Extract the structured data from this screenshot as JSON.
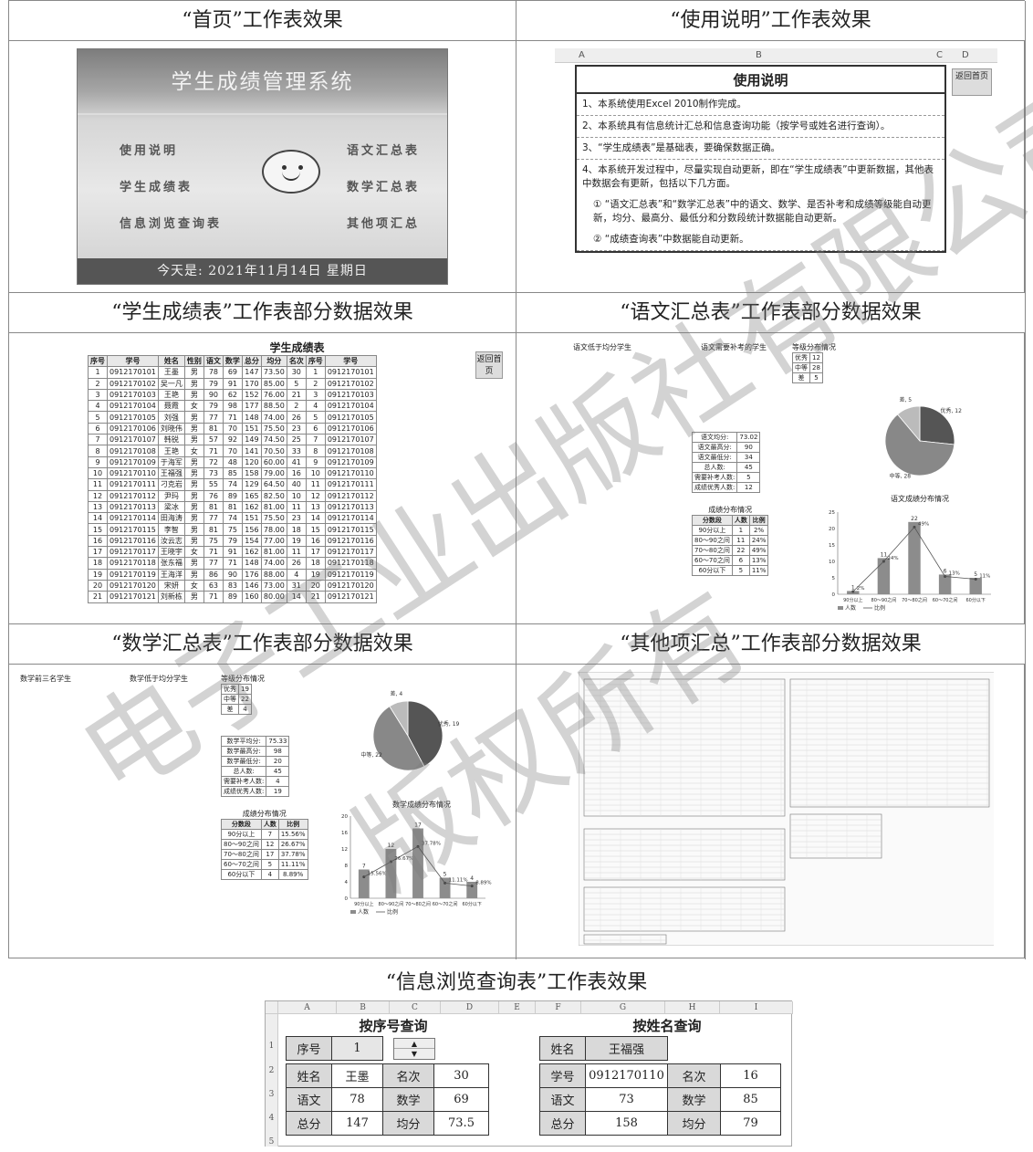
{
  "captions": {
    "home": "“首页”工作表效果",
    "help": "“使用说明”工作表效果",
    "grades": "“学生成绩表”工作表部分数据效果",
    "chinese": "“语文汇总表”工作表部分数据效果",
    "math": "“数学汇总表”工作表部分数据效果",
    "other": "“其他项汇总”工作表部分数据效果",
    "query": "“信息浏览查询表”工作表效果"
  },
  "home": {
    "title": "学生成绩管理系统",
    "items": [
      "使用说明",
      "学生成绩表",
      "信息浏览查询表",
      "语文汇总表",
      "数学汇总表",
      "其他项汇总"
    ],
    "footer": "今天是:    2021年11月14日   星期日"
  },
  "help": {
    "cols": [
      "A",
      "B",
      "C",
      "D"
    ],
    "title": "使用说明",
    "back": "返回首页",
    "lines": [
      "1、本系统使用Excel 2010制作完成。",
      "2、本系统具有信息统计汇总和信息查询功能（按学号或姓名进行查询）。",
      "3、“学生成绩表”是基础表，要确保数据正确。",
      "4、本系统开发过程中，尽量实现自动更新，即在“学生成绩表”中更新数据，其他表中数据会有更新，包括以下几方面。",
      "① “语文汇总表”和“数学汇总表”中的语文、数学、是否补考和成绩等级能自动更新，均分、最高分、最低分和分数段统计数据能自动更新。",
      "② “成绩查询表”中数据能自动更新。"
    ]
  },
  "grades": {
    "title": "学生成绩表",
    "back": "返回首页",
    "headers": [
      "序号",
      "学号",
      "姓名",
      "性别",
      "语文",
      "数学",
      "总分",
      "均分",
      "名次",
      "序号",
      "学号"
    ],
    "rows": [
      [
        "1",
        "0912170101",
        "王墨",
        "男",
        "78",
        "69",
        "147",
        "73.50",
        "30",
        "1",
        "0912170101"
      ],
      [
        "2",
        "0912170102",
        "吴一凡",
        "男",
        "79",
        "91",
        "170",
        "85.00",
        "5",
        "2",
        "0912170102"
      ],
      [
        "3",
        "0912170103",
        "王艳",
        "男",
        "90",
        "62",
        "152",
        "76.00",
        "21",
        "3",
        "0912170103"
      ],
      [
        "4",
        "0912170104",
        "聂霞",
        "女",
        "79",
        "98",
        "177",
        "88.50",
        "2",
        "4",
        "0912170104"
      ],
      [
        "5",
        "0912170105",
        "刘强",
        "男",
        "77",
        "71",
        "148",
        "74.00",
        "26",
        "5",
        "0912170105"
      ],
      [
        "6",
        "0912170106",
        "刘晓伟",
        "男",
        "81",
        "70",
        "151",
        "75.50",
        "23",
        "6",
        "0912170106"
      ],
      [
        "7",
        "0912170107",
        "韩锐",
        "男",
        "57",
        "92",
        "149",
        "74.50",
        "25",
        "7",
        "0912170107"
      ],
      [
        "8",
        "0912170108",
        "王艳",
        "女",
        "71",
        "70",
        "141",
        "70.50",
        "33",
        "8",
        "0912170108"
      ],
      [
        "9",
        "0912170109",
        "于海军",
        "男",
        "72",
        "48",
        "120",
        "60.00",
        "41",
        "9",
        "0912170109"
      ],
      [
        "10",
        "0912170110",
        "王福强",
        "男",
        "73",
        "85",
        "158",
        "79.00",
        "16",
        "10",
        "0912170110"
      ],
      [
        "11",
        "0912170111",
        "刁克岩",
        "男",
        "55",
        "74",
        "129",
        "64.50",
        "40",
        "11",
        "0912170111"
      ],
      [
        "12",
        "0912170112",
        "尹玛",
        "男",
        "76",
        "89",
        "165",
        "82.50",
        "10",
        "12",
        "0912170112"
      ],
      [
        "13",
        "0912170113",
        "梁冰",
        "男",
        "81",
        "81",
        "162",
        "81.00",
        "11",
        "13",
        "0912170113"
      ],
      [
        "14",
        "0912170114",
        "田海涛",
        "男",
        "77",
        "74",
        "151",
        "75.50",
        "23",
        "14",
        "0912170114"
      ],
      [
        "15",
        "0912170115",
        "李智",
        "男",
        "81",
        "75",
        "156",
        "78.00",
        "18",
        "15",
        "0912170115"
      ],
      [
        "16",
        "0912170116",
        "汝云志",
        "男",
        "75",
        "79",
        "154",
        "77.00",
        "19",
        "16",
        "0912170116"
      ],
      [
        "17",
        "0912170117",
        "王晓宇",
        "女",
        "71",
        "91",
        "162",
        "81.00",
        "11",
        "17",
        "0912170117"
      ],
      [
        "18",
        "0912170118",
        "张东福",
        "男",
        "77",
        "71",
        "148",
        "74.00",
        "26",
        "18",
        "0912170118"
      ],
      [
        "19",
        "0912170119",
        "王海洋",
        "男",
        "86",
        "90",
        "176",
        "88.00",
        "4",
        "19",
        "0912170119"
      ],
      [
        "20",
        "0912170120",
        "宋妍",
        "女",
        "63",
        "83",
        "146",
        "73.00",
        "31",
        "20",
        "0912170120"
      ],
      [
        "21",
        "0912170121",
        "刘新栋",
        "男",
        "71",
        "89",
        "160",
        "80.00",
        "14",
        "21",
        "0912170121"
      ]
    ]
  },
  "chinese": {
    "low_title": "语文低于均分学生",
    "makeup_title": "语文需要补考的学生",
    "level_title": "等级分布情况",
    "levels": [
      [
        "优秀",
        "12"
      ],
      [
        "中等",
        "28"
      ],
      [
        "差",
        "5"
      ]
    ],
    "stats": [
      [
        "语文均分:",
        "73.02"
      ],
      [
        "语文最高分:",
        "90"
      ],
      [
        "语文最低分:",
        "34"
      ],
      [
        "总人数:",
        "45"
      ],
      [
        "需要补考人数:",
        "5"
      ],
      [
        "成绩优秀人数:",
        "12"
      ]
    ],
    "dist_title": "成绩分布情况",
    "dist_headers": [
      "分数段",
      "人数",
      "比例"
    ],
    "dist": [
      [
        "90分以上",
        "1",
        "2%"
      ],
      [
        "80～90之间",
        "11",
        "24%"
      ],
      [
        "70～80之间",
        "22",
        "49%"
      ],
      [
        "60～70之间",
        "6",
        "13%"
      ],
      [
        "60分以下",
        "5",
        "11%"
      ]
    ],
    "chart_title": "语文成绩分布情况"
  },
  "math": {
    "top3_title": "数学前三名学生",
    "low_title": "数学低于均分学生",
    "level_title": "等级分布情况",
    "levels": [
      [
        "优秀",
        "19"
      ],
      [
        "中等",
        "22"
      ],
      [
        "差",
        "4"
      ]
    ],
    "stats": [
      [
        "数学平均分:",
        "75.33"
      ],
      [
        "数学最高分:",
        "98"
      ],
      [
        "数学最低分:",
        "20"
      ],
      [
        "总人数:",
        "45"
      ],
      [
        "需要补考人数:",
        "4"
      ],
      [
        "成绩优秀人数:",
        "19"
      ]
    ],
    "dist_title": "成绩分布情况",
    "dist_headers": [
      "分数段",
      "人数",
      "比例"
    ],
    "dist": [
      [
        "90分以上",
        "7",
        "15.56%"
      ],
      [
        "80～90之间",
        "12",
        "26.67%"
      ],
      [
        "70～80之间",
        "17",
        "37.78%"
      ],
      [
        "60～70之间",
        "5",
        "11.11%"
      ],
      [
        "60分以下",
        "4",
        "8.89%"
      ]
    ],
    "chart_title": "数学成绩分布情况"
  },
  "chart_data": [
    {
      "type": "bar",
      "title": "语文成绩分布情况",
      "categories": [
        "90分以上",
        "80～90之间",
        "70～80之间",
        "60～70之间",
        "60分以下"
      ],
      "series": [
        {
          "name": "人数",
          "values": [
            1,
            11,
            22,
            6,
            5
          ]
        },
        {
          "name": "比例",
          "values": [
            2,
            24,
            49,
            13,
            11
          ]
        }
      ],
      "ylim": [
        0,
        25
      ]
    },
    {
      "type": "bar",
      "title": "数学成绩分布情况",
      "categories": [
        "90分以上",
        "80～90之间",
        "70～80之间",
        "60～70之间",
        "60分以下"
      ],
      "series": [
        {
          "name": "人数",
          "values": [
            7,
            12,
            17,
            5,
            4
          ]
        },
        {
          "name": "比例",
          "values": [
            15.56,
            26.67,
            37.78,
            11.11,
            8.89
          ]
        }
      ],
      "ylim": [
        0,
        20
      ]
    }
  ],
  "query": {
    "cols": [
      "A",
      "B",
      "C",
      "D",
      "E",
      "F",
      "G",
      "H",
      "I"
    ],
    "by_no_title": "按序号查询",
    "by_name_title": "按姓名查询",
    "left": {
      "no_label": "序号",
      "no_value": "1",
      "rows": [
        [
          "姓名",
          "王墨",
          "名次",
          "30"
        ],
        [
          "语文",
          "78",
          "数学",
          "69"
        ],
        [
          "总分",
          "147",
          "均分",
          "73.5"
        ]
      ]
    },
    "right": {
      "name_label": "姓名",
      "name_value": "王福强",
      "rows": [
        [
          "学号",
          "0912170110",
          "名次",
          "16"
        ],
        [
          "语文",
          "73",
          "数学",
          "85"
        ],
        [
          "总分",
          "158",
          "均分",
          "79"
        ]
      ]
    }
  },
  "watermark": [
    "电子工业出版社有限公司",
    "版权所有"
  ]
}
